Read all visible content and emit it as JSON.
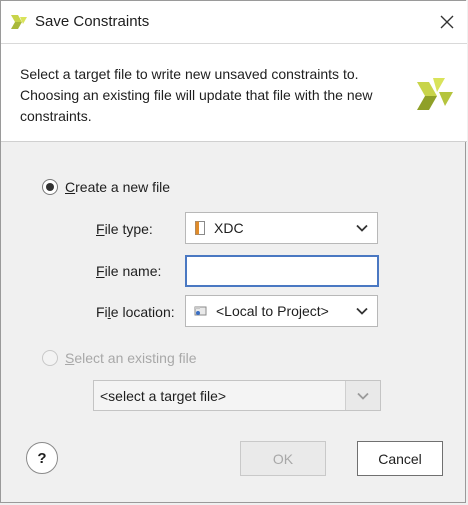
{
  "window": {
    "title": "Save Constraints",
    "close_icon": "close-icon"
  },
  "header": {
    "description": "Select a target file to write new unsaved constraints to. Choosing an existing file will update that file with the new constraints."
  },
  "options": {
    "create_new": {
      "label_first": "C",
      "label_rest": "reate a new file",
      "selected": true
    },
    "select_existing": {
      "label_first": "S",
      "label_rest": "elect an existing file",
      "selected": false,
      "enabled": false
    }
  },
  "fields": {
    "file_type": {
      "label_first": "F",
      "label_rest": "ile type:",
      "value": "XDC"
    },
    "file_name": {
      "label_first": "F",
      "label_rest": "ile name:",
      "value": ""
    },
    "file_location": {
      "label_prefix": "Fi",
      "label_ul": "l",
      "label_rest": "e location:",
      "value": "<Local to Project>"
    }
  },
  "target_file": {
    "value": "<select a target file>"
  },
  "buttons": {
    "help": "?",
    "ok": "OK",
    "cancel": "Cancel",
    "ok_enabled": false
  }
}
